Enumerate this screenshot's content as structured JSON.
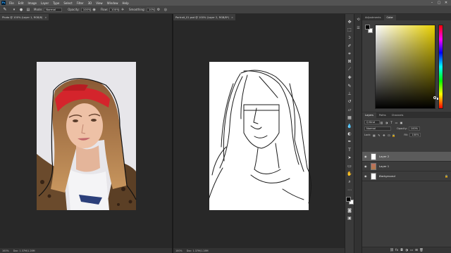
{
  "app": {
    "logo_text": "Ps"
  },
  "menu": [
    "File",
    "Edit",
    "Image",
    "Layer",
    "Type",
    "Select",
    "Filter",
    "3D",
    "View",
    "Window",
    "Help"
  ],
  "window_controls": {
    "minimize": "–",
    "restore": "▢",
    "close": "✕"
  },
  "options_bar": {
    "tool_icon": "brush-icon",
    "mode_label": "Mode:",
    "mode_value": "Normal",
    "opacity_label": "Opacity:",
    "opacity_value": "100%",
    "flow_label": "Flow:",
    "flow_value": "100%",
    "smoothing_label": "Smoothing:",
    "smoothing_value": "10%"
  },
  "documents": [
    {
      "tab_title": "Photo @ 100% (Layer 1, RGB/8)",
      "tab_close": "×",
      "status_zoom": "100%",
      "status_doc": "Doc: 1.37M/1.28M"
    },
    {
      "tab_title": "Portrait_01.psd @ 100% (Layer 2, RGB/8*)",
      "tab_close": "×",
      "status_zoom": "100%",
      "status_doc": "Doc: 1.37M/1.28M"
    }
  ],
  "panels": {
    "top_tabs": [
      "Adjustments",
      "Color"
    ],
    "active_top_tab": "Color",
    "layer_tabs": [
      "Layers",
      "Paths",
      "Channels"
    ],
    "active_layer_tab": "Layers",
    "kind_label": "Q Kind",
    "blend_mode": "Normal",
    "opacity_label": "Opacity:",
    "opacity_value": "100%",
    "lock_label": "Lock:",
    "fill_label": "Fill:",
    "fill_value": "100%",
    "layers": [
      {
        "name": "Layer 2",
        "visible": true,
        "selected": true,
        "thumb": "white"
      },
      {
        "name": "Layer 1",
        "visible": true,
        "selected": false,
        "thumb": "photo"
      },
      {
        "name": "Background",
        "visible": true,
        "selected": false,
        "thumb": "white",
        "locked": true
      }
    ],
    "foreground_color": "#000000",
    "background_color": "#ffffff",
    "picker_hue": "#e8d000"
  }
}
